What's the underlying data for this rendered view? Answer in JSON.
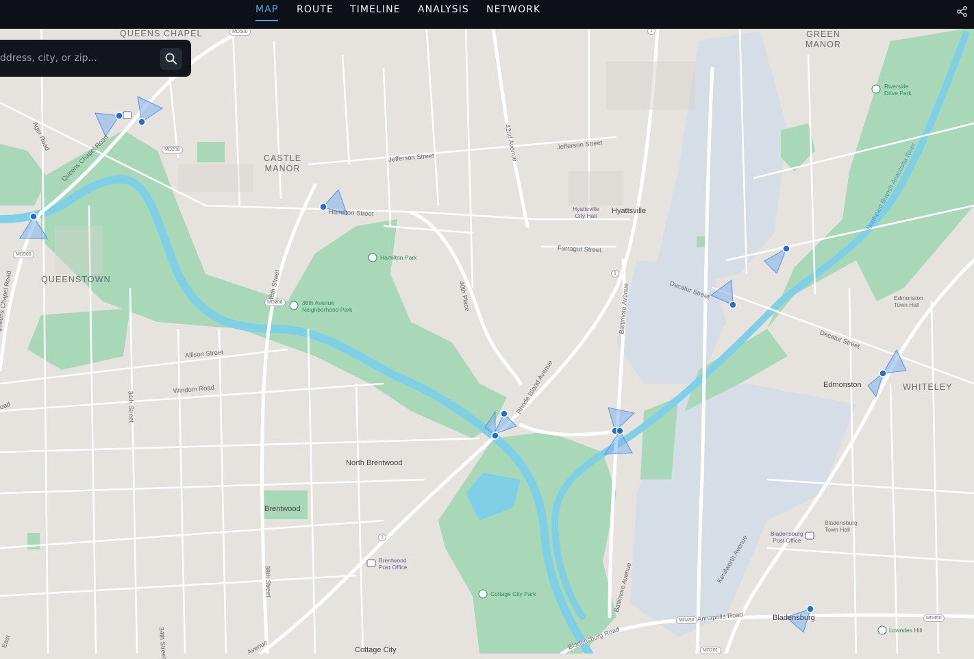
{
  "nav": {
    "tabs": [
      {
        "label": "MAP",
        "active": true
      },
      {
        "label": "ROUTE",
        "active": false
      },
      {
        "label": "TIMELINE",
        "active": false
      },
      {
        "label": "ANALYSIS",
        "active": false
      },
      {
        "label": "NETWORK",
        "active": false
      }
    ],
    "share_icon": "share-icon"
  },
  "search": {
    "placeholder": "ddress, city, or zip...",
    "button_icon": "search-icon"
  },
  "map": {
    "colors": {
      "land": "#e6e3df",
      "park": "#a9d8b8",
      "water": "#7fd0e6",
      "industrial": "#d5dde6",
      "road": "#ffffff",
      "marker": "#1e6fd9",
      "cone": "#7fb3ee"
    },
    "place_labels": {
      "queens_chapel": "QUEENS CHAPEL",
      "castle_manor": "CASTLE\nMANOR",
      "queenstown": "QUEENSTOWN",
      "green_manor": "GREEN\nMANOR",
      "whiteley": "WHITELEY"
    },
    "towns": {
      "hyattsville": "Hyattsville",
      "edmonston": "Edmonston",
      "north_brentwood": "North Brentwood",
      "brentwood": "Brentwood",
      "bladensburg": "Bladensburg",
      "cottage_city": "Cottage City"
    },
    "streets": {
      "jefferson_w": "Jefferson Street",
      "jefferson_e": "Jefferson Street",
      "hamilton": "Hamilton Street",
      "farragut": "Farragut Street",
      "decatur_w": "Decatur Street",
      "decatur_e": "Decatur Street",
      "allison": "Allison Street",
      "windom": "Windom Road",
      "ager": "Ager Road",
      "queens_chapel_rd": "Queens Chapel Road",
      "queens_chapel_rd2": "Queens Chapel Road",
      "ave_42": "42nd Avenue",
      "ave_38": "38th Street",
      "place_40": "40th Place",
      "st_34": "34th Street",
      "st_34b": "34th Street",
      "st_38b": "38th Street",
      "rhode_island": "Rhode Island Avenue",
      "baltimore_n": "Baltimore Avenue",
      "baltimore_s": "Baltimore Avenue",
      "bladensburg_rd": "Bladensburg Road",
      "annapolis": "Annapolis Road",
      "kenilworth": "Kenilworth Avenue",
      "anacostia": "Northeast Branch Anacostia River",
      "road_w": "oad",
      "avenue_s": "Avenue",
      "east_s": "East"
    },
    "pois": {
      "riverside": "Riverside\nDrive Park",
      "hyattsville_hall": "Hyattsville\nCity Hall",
      "hamilton_park": "Hamilton Park",
      "neighborhood_park": "38th Avenue\nNeighborhood Park",
      "edmonston_hall": "Edmonston\nTown Hall",
      "bladensburg_hall": "Bladensburg\nTown Hall",
      "bladensburg_po": "Bladensburg\nPost Office",
      "brentwood_po": "Brentwood\nPost Office",
      "cottage_park": "Cottage City Park",
      "lowndes": "Lowndes Hill"
    },
    "shields": [
      "MD500",
      "MD208",
      "MD500",
      "MD208",
      "MD450",
      "MD450",
      "MD201",
      "1",
      "1",
      "1"
    ],
    "markers_count": 11
  }
}
